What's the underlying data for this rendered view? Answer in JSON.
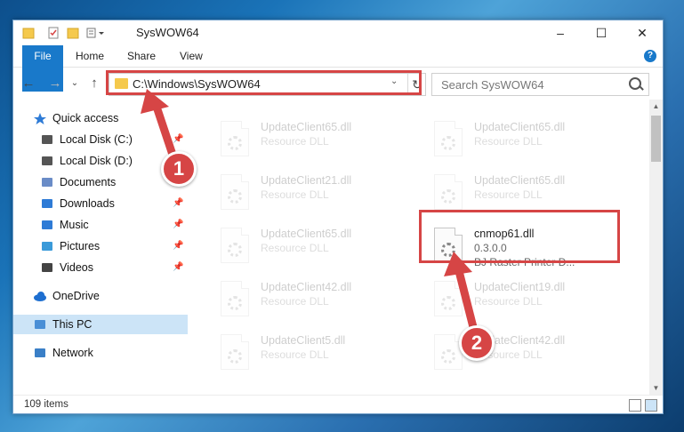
{
  "window": {
    "title": "SysWOW64",
    "controls": {
      "minimize": "–",
      "maximize": "☐",
      "close": "✕"
    }
  },
  "ribbon": {
    "tabs": [
      "File",
      "Home",
      "Share",
      "View"
    ],
    "help": "?"
  },
  "navigation": {
    "address": "C:\\Windows\\SysWOW64",
    "search_placeholder": "Search SysWOW64"
  },
  "sidebar": {
    "items": [
      {
        "label": "Quick access",
        "icon": "star-icon",
        "pinned": false
      },
      {
        "label": "Local Disk (C:)",
        "icon": "drive-icon",
        "pinned": true
      },
      {
        "label": "Local Disk (D:)",
        "icon": "drive-icon",
        "pinned": false
      },
      {
        "label": "Documents",
        "icon": "documents-icon",
        "pinned": true
      },
      {
        "label": "Downloads",
        "icon": "downloads-icon",
        "pinned": true
      },
      {
        "label": "Music",
        "icon": "music-icon",
        "pinned": true
      },
      {
        "label": "Pictures",
        "icon": "pictures-icon",
        "pinned": true
      },
      {
        "label": "Videos",
        "icon": "videos-icon",
        "pinned": true
      },
      {
        "label": "OneDrive",
        "icon": "cloud-icon",
        "pinned": false
      },
      {
        "label": "This PC",
        "icon": "computer-icon",
        "pinned": false,
        "selected": true
      },
      {
        "label": "Network",
        "icon": "network-icon",
        "pinned": false
      }
    ]
  },
  "files": [
    {
      "name": "UpdateClient65.dll",
      "desc": "Resource DLL",
      "faded": true
    },
    {
      "name": "UpdateClient65.dll",
      "desc": "Resource DLL",
      "faded": true
    },
    {
      "name": "UpdateClient21.dll",
      "desc": "Resource DLL",
      "faded": true
    },
    {
      "name": "UpdateClient65.dll",
      "desc": "Resource DLL",
      "faded": true
    },
    {
      "name": "UpdateClient65.dll",
      "desc": "Resource DLL",
      "faded": true
    },
    {
      "name": "cnmop61.dll",
      "desc": "0.3.0.0",
      "desc2": "BJ Raster Printer D...",
      "faded": false
    },
    {
      "name": "UpdateClient42.dll",
      "desc": "Resource DLL",
      "faded": true
    },
    {
      "name": "UpdateClient19.dll",
      "desc": "Resource DLL",
      "faded": true
    },
    {
      "name": "UpdateClient5.dll",
      "desc": "Resource DLL",
      "faded": true
    },
    {
      "name": "UpdateClient42.dll",
      "desc": "Resource DLL",
      "faded": true
    }
  ],
  "status": {
    "item_count": "109 items"
  },
  "annotations": {
    "step1": "1",
    "step2": "2",
    "color": "#d64545"
  }
}
